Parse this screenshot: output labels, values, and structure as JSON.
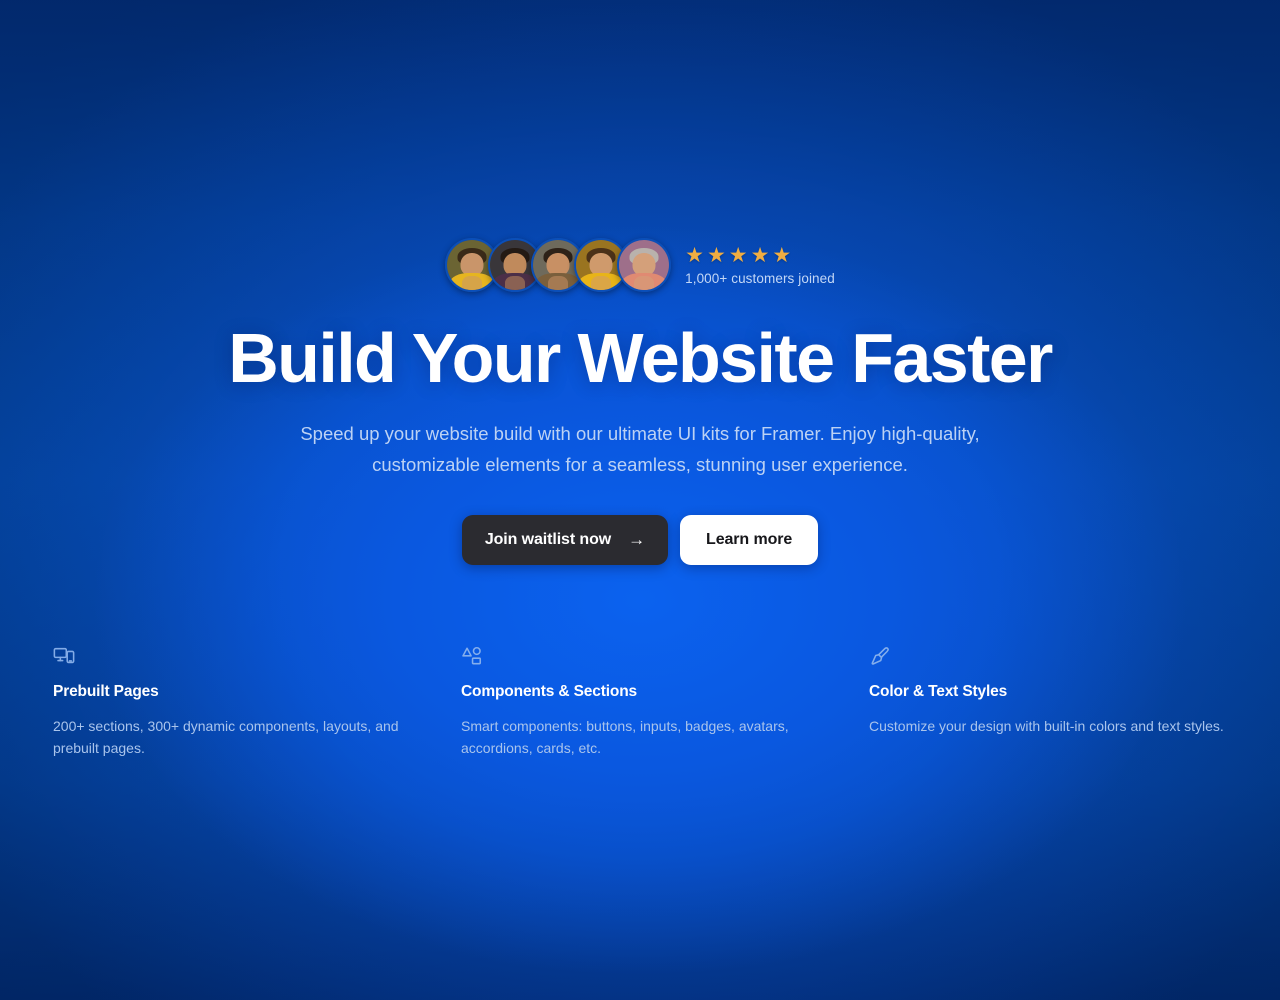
{
  "hero": {
    "headline": "Build Your Website Faster",
    "subtitle": "Speed up your website build with our ultimate UI kits for Framer. Enjoy high-quality, customizable elements for a seamless, stunning user experience.",
    "social_proof": {
      "customers_text": "1,000+ customers joined",
      "stars": [
        "★",
        "★",
        "★",
        "★",
        "★"
      ],
      "star_color": "#f0ad42",
      "avatars": [
        {
          "name": "avatar-1",
          "bg": "#6b6433",
          "hair": "#3a2a18",
          "skin": "#c9956a",
          "clothing": "#e6b520"
        },
        {
          "name": "avatar-2",
          "bg": "#39363a",
          "hair": "#241a14",
          "skin": "#c08a5c",
          "clothing": "#4b2f48"
        },
        {
          "name": "avatar-3",
          "bg": "#6e6a5c",
          "hair": "#2e2218",
          "skin": "#c89064",
          "clothing": "#7a5f3c"
        },
        {
          "name": "avatar-4",
          "bg": "#9a7420",
          "hair": "#4b3118",
          "skin": "#cf9a6c",
          "clothing": "#e8b418"
        },
        {
          "name": "avatar-5",
          "bg": "#9e6f8a",
          "hair": "#b9b2ac",
          "skin": "#d4a07a",
          "clothing": "#e08a72"
        }
      ]
    },
    "buttons": {
      "primary_label": "Join waitlist now",
      "primary_icon": "arrow-right-icon",
      "primary_arrow": "→",
      "secondary_label": "Learn more"
    }
  },
  "features": [
    {
      "icon": "devices-icon",
      "title": "Prebuilt Pages",
      "description": "200+ sections, 300+ dynamic components, layouts, and prebuilt pages."
    },
    {
      "icon": "shapes-icon",
      "title": "Components & Sections",
      "description": "Smart components: buttons, inputs, badges, avatars, accordions, cards, etc."
    },
    {
      "icon": "paintbrush-icon",
      "title": "Color & Text Styles",
      "description": "Customize your design with built-in colors and text styles."
    }
  ],
  "theme": {
    "background_dark": "#022f7d",
    "background_bright": "#0b62ef",
    "text_primary": "#ffffff",
    "text_muted": "#bcd2f4",
    "button_primary_bg": "#2b2b30",
    "button_secondary_bg": "#ffffff"
  }
}
